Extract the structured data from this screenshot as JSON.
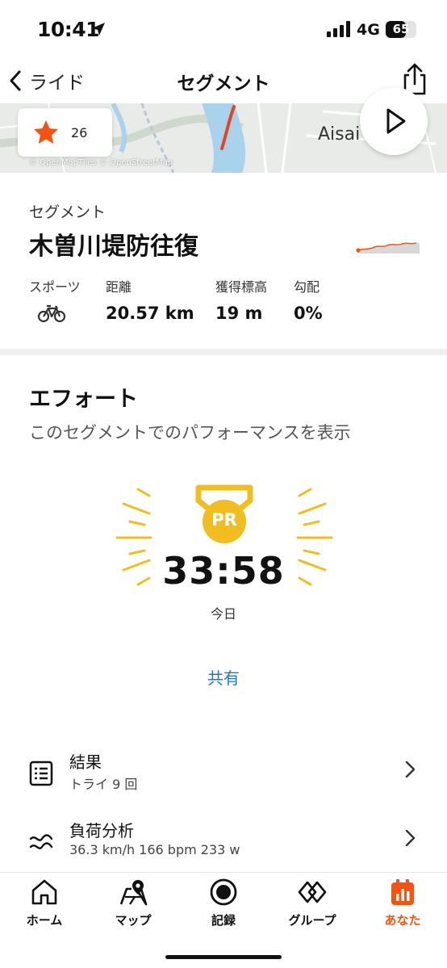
{
  "status_bar": {
    "time": "10:41",
    "network": "4G",
    "battery": "65",
    "battery_level": 0.65
  },
  "nav": {
    "back_label": "ライド",
    "title": "セグメント"
  },
  "map": {
    "star_count": "26",
    "place_label": "Aisai",
    "attribution": "© OpenMapTiles © OpenStreetMap"
  },
  "segment": {
    "kicker": "セグメント",
    "name": "木曽川堤防往復",
    "stats": [
      {
        "label": "スポーツ",
        "icon": "bike-icon"
      },
      {
        "label": "距離",
        "value": "20.57 km"
      },
      {
        "label": "獲得標高",
        "value": "19 m"
      },
      {
        "label": "勾配",
        "value": "0%"
      }
    ]
  },
  "effort": {
    "title": "エフォート",
    "subtitle": "このセグメントでのパフォーマンスを表示",
    "badge": "PR",
    "time": "33:58",
    "date": "今日",
    "share_label": "共有"
  },
  "rows": [
    {
      "title": "結果",
      "subtitle": "トライ 9 回",
      "icon": "results-list-icon"
    },
    {
      "title": "負荷分析",
      "subtitle": "36.3 km/h 166 bpm 233 w",
      "icon": "pulse-icon"
    }
  ],
  "tabs": [
    {
      "label": "ホーム",
      "icon": "home-icon"
    },
    {
      "label": "マップ",
      "icon": "map-icon"
    },
    {
      "label": "記録",
      "icon": "record-icon"
    },
    {
      "label": "グループ",
      "icon": "groups-icon"
    },
    {
      "label": "あなた",
      "icon": "you-icon",
      "active": true
    }
  ],
  "colors": {
    "brand_orange": "#f5530f",
    "link_blue": "#1b78d0",
    "pr_gold": "#f2bd1f"
  }
}
